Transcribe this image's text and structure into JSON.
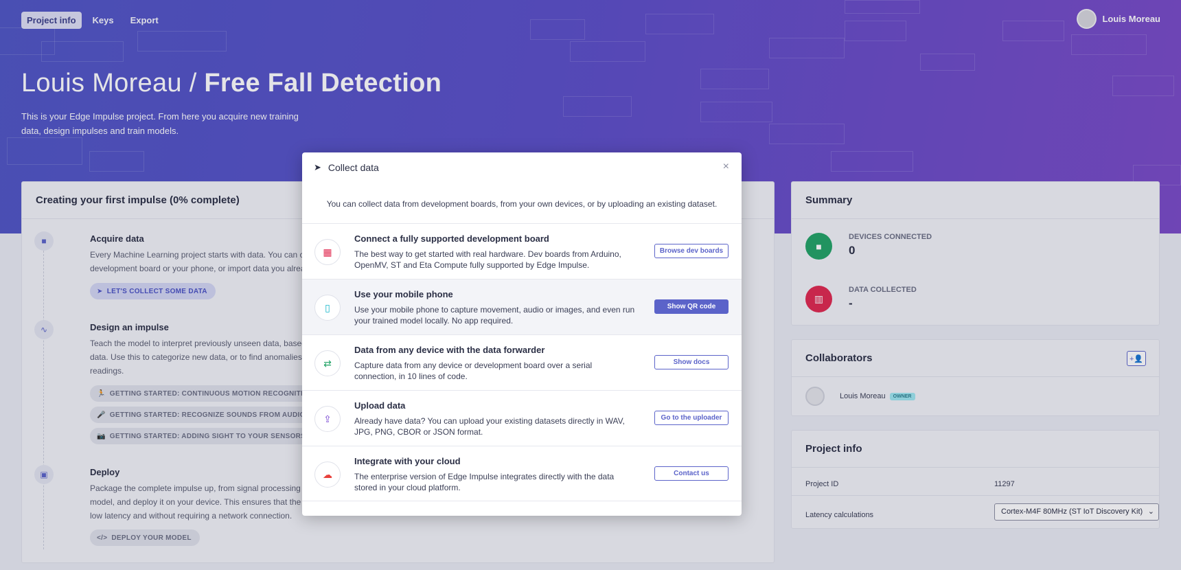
{
  "nav": {
    "tabs": [
      "Project info",
      "Keys",
      "Export"
    ],
    "active": "Project info"
  },
  "user": {
    "name": "Louis Moreau"
  },
  "hero": {
    "owner": "Louis Moreau /",
    "project": "Free Fall Detection",
    "description": "This is your Edge Impulse project. From here you acquire new training data, design impulses and train models."
  },
  "impulse_card": {
    "title": "Creating your first impulse (0% complete)",
    "steps": [
      {
        "title": "Acquire data",
        "text": "Every Machine Learning project starts with data. You can capture da a development board or your phone, or import data you already coll",
        "buttons": [
          "LET'S COLLECT SOME DATA"
        ]
      },
      {
        "title": "Design an impulse",
        "text": "Teach the model to interpret previously unseen data, based on histo data. Use this to categorize new data, or to find anomalies in sensor readings.",
        "buttons": [
          "GETTING STARTED: CONTINUOUS MOTION RECOGNITION",
          "GETTING STARTED: RECOGNIZE SOUNDS FROM AUDIO",
          "GETTING STARTED: ADDING SIGHT TO YOUR SENSORS"
        ]
      },
      {
        "title": "Deploy",
        "text": "Package the complete impulse up, from signal processing code to tra model, and deploy it on your device. This ensures that the impulse r low latency and without requiring a network connection.",
        "buttons": [
          "DEPLOY YOUR MODEL"
        ]
      }
    ]
  },
  "summary": {
    "title": "Summary",
    "items": [
      {
        "label": "DEVICES CONNECTED",
        "value": "0",
        "color": "#21a366"
      },
      {
        "label": "DATA COLLECTED",
        "value": "-",
        "color": "#e0284f"
      }
    ]
  },
  "collaborators": {
    "title": "Collaborators",
    "members": [
      {
        "name": "Louis Moreau",
        "badge": "OWNER"
      }
    ]
  },
  "project_info": {
    "title": "Project info",
    "rows": [
      {
        "label": "Project ID",
        "value": "11297"
      },
      {
        "label": "Latency calculations",
        "value": "Cortex-M4F 80MHz (ST IoT Discovery Kit)"
      }
    ]
  },
  "modal": {
    "title": "Collect data",
    "intro": "You can collect data from development boards, from your own devices, or by uploading an existing dataset.",
    "options": [
      {
        "title": "Connect a fully supported development board",
        "text": "The best way to get started with real hardware. Dev boards from Arduino, OpenMV, ST and Eta Compute fully supported by Edge Impulse.",
        "button": "Browse dev boards",
        "icon": "chip-icon",
        "color": "#e0284f"
      },
      {
        "title": "Use your mobile phone",
        "text": "Use your mobile phone to capture movement, audio or images, and even run your trained model locally. No app required.",
        "button": "Show QR code",
        "icon": "phone-icon",
        "color": "#12b5c9"
      },
      {
        "title": "Data from any device with the data forwarder",
        "text": "Capture data from any device or development board over a serial connection, in 10 lines of code.",
        "button": "Show docs",
        "icon": "arrows-icon",
        "color": "#21a366"
      },
      {
        "title": "Upload data",
        "text": "Already have data? You can upload your existing datasets directly in WAV, JPG, PNG, CBOR or JSON format.",
        "button": "Go to the uploader",
        "icon": "upload-icon",
        "color": "#7b4bd3"
      },
      {
        "title": "Integrate with your cloud",
        "text": "The enterprise version of Edge Impulse integrates directly with the data stored in your cloud platform.",
        "button": "Contact us",
        "icon": "cloud-icon",
        "color": "#e8413c"
      }
    ]
  },
  "colors": {
    "accent": "#5b63c9",
    "hero_start": "#4f56c4",
    "hero_end": "#7a4bc6"
  }
}
